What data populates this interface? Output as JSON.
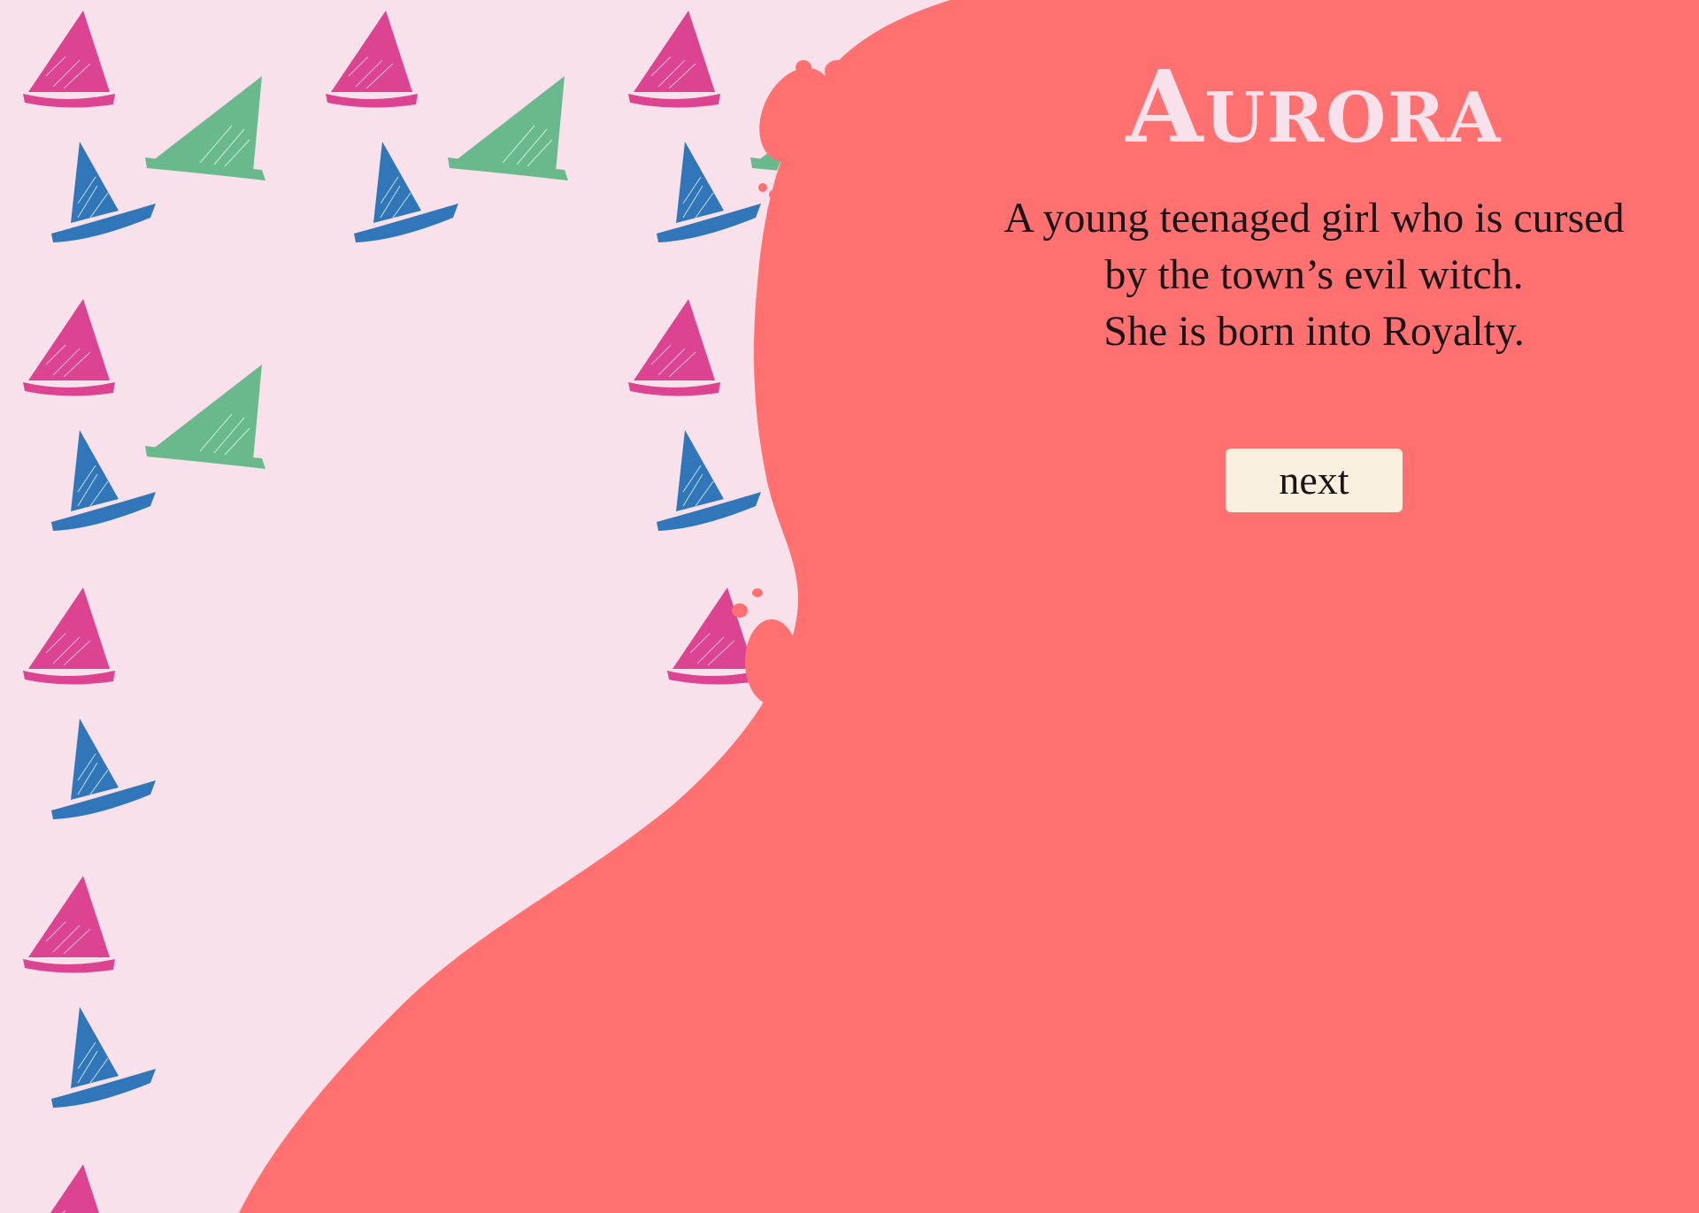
{
  "character": {
    "name": "Aurora",
    "description_lines": [
      "A young teenaged girl who is cursed",
      "by the town’s evil witch.",
      "She is born into Royalty."
    ]
  },
  "navigation": {
    "next_label": "next"
  },
  "colors": {
    "background": "#f9e1ec",
    "coral_panel": "#ff7170",
    "title_text": "#f9e1ec",
    "body_text": "#1d1419",
    "button_bg": "#f8efdf",
    "hat_pink": "#dc4390",
    "hat_green": "#69b98d",
    "hat_blue": "#3176b8"
  },
  "icons": {
    "pattern_hat_pink": "witch-hat-pink-icon",
    "pattern_hat_green": "witch-hat-green-icon",
    "pattern_hat_blue": "witch-hat-blue-icon"
  }
}
